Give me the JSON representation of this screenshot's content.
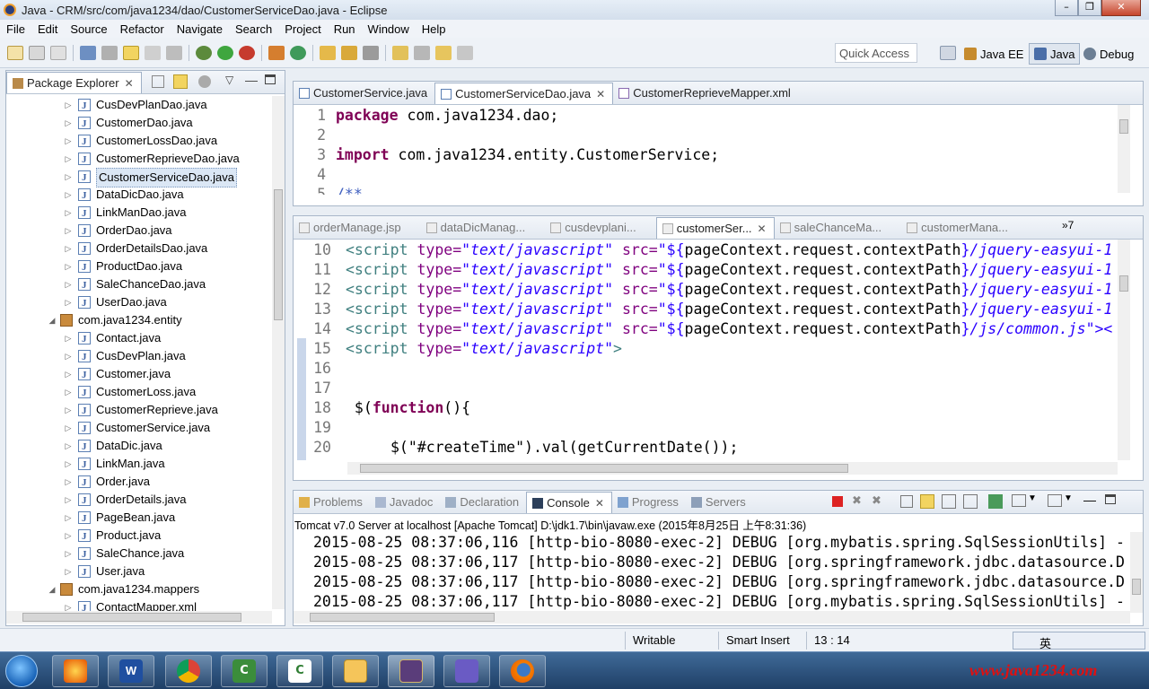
{
  "window": {
    "title": "Java - CRM/src/com/java1234/dao/CustomerServiceDao.java - Eclipse"
  },
  "menu": [
    "File",
    "Edit",
    "Source",
    "Refactor",
    "Navigate",
    "Search",
    "Project",
    "Run",
    "Window",
    "Help"
  ],
  "toolbar": {
    "quick_access": "Quick Access",
    "perspectives": [
      "Java EE",
      "Java",
      "Debug"
    ]
  },
  "package_explorer": {
    "title": "Package Explorer",
    "items": [
      {
        "label": "CusDevPlanDao.java",
        "kind": "file"
      },
      {
        "label": "CustomerDao.java",
        "kind": "file"
      },
      {
        "label": "CustomerLossDao.java",
        "kind": "file"
      },
      {
        "label": "CustomerReprieveDao.java",
        "kind": "file"
      },
      {
        "label": "CustomerServiceDao.java",
        "kind": "file",
        "selected": true
      },
      {
        "label": "DataDicDao.java",
        "kind": "file"
      },
      {
        "label": "LinkManDao.java",
        "kind": "file"
      },
      {
        "label": "OrderDao.java",
        "kind": "file"
      },
      {
        "label": "OrderDetailsDao.java",
        "kind": "file"
      },
      {
        "label": "ProductDao.java",
        "kind": "file"
      },
      {
        "label": "SaleChanceDao.java",
        "kind": "file"
      },
      {
        "label": "UserDao.java",
        "kind": "file"
      },
      {
        "label": "com.java1234.entity",
        "kind": "package"
      },
      {
        "label": "Contact.java",
        "kind": "file"
      },
      {
        "label": "CusDevPlan.java",
        "kind": "file"
      },
      {
        "label": "Customer.java",
        "kind": "file"
      },
      {
        "label": "CustomerLoss.java",
        "kind": "file"
      },
      {
        "label": "CustomerReprieve.java",
        "kind": "file"
      },
      {
        "label": "CustomerService.java",
        "kind": "file"
      },
      {
        "label": "DataDic.java",
        "kind": "file"
      },
      {
        "label": "LinkMan.java",
        "kind": "file"
      },
      {
        "label": "Order.java",
        "kind": "file"
      },
      {
        "label": "OrderDetails.java",
        "kind": "file"
      },
      {
        "label": "PageBean.java",
        "kind": "file"
      },
      {
        "label": "Product.java",
        "kind": "file"
      },
      {
        "label": "SaleChance.java",
        "kind": "file"
      },
      {
        "label": "User.java",
        "kind": "file"
      },
      {
        "label": "com.java1234.mappers",
        "kind": "package"
      },
      {
        "label": "ContactMapper.xml",
        "kind": "file"
      }
    ]
  },
  "editor_top": {
    "tabs": [
      "CustomerService.java",
      "CustomerServiceDao.java",
      "CustomerReprieveMapper.xml"
    ],
    "active_tab": 1,
    "line_numbers": [
      "1",
      "2",
      "3",
      "4",
      "5"
    ],
    "line1_kw": "package",
    "line1_rest": " com.java1234.dao;",
    "line3_kw": "import",
    "line3_rest": " com.java1234.entity.CustomerService;",
    "line5": "/**"
  },
  "editor_bottom": {
    "tabs": [
      "orderManage.jsp",
      "dataDicManag...",
      "cusdevplani...",
      "customerSer...",
      "saleChanceMa...",
      "customerMana..."
    ],
    "active_tab": 3,
    "overflow": "»7",
    "line_numbers": [
      "10",
      "11",
      "12",
      "13",
      "14",
      "15",
      "16",
      "17",
      "18",
      "19",
      "20"
    ],
    "script_tag": "<script",
    "type_attr": " type=",
    "type_val": "\"text/javascript\"",
    "src_attr": " src=",
    "src_open": "\"${",
    "src_expr": "pageContext.request.contextPath",
    "src_close": "}",
    "path_easyui": "/jquery-easyui-1",
    "path_common": "/js/common.js",
    "line14_end": "\"><",
    "line15_end": ">",
    "line18_a": " $(",
    "line18_kw": "function",
    "line18_b": "(){",
    "line20": "$(\"#createTime\").val(getCurrentDate());"
  },
  "console": {
    "tabs": [
      "Problems",
      "Javadoc",
      "Declaration",
      "Console",
      "Progress",
      "Servers"
    ],
    "active_tab": 3,
    "header": "Tomcat v7.0 Server at localhost [Apache Tomcat] D:\\jdk1.7\\bin\\javaw.exe (2015年8月25日 上午8:31:36)",
    "lines": [
      "2015-08-25 08:37:06,116 [http-bio-8080-exec-2] DEBUG [org.mybatis.spring.SqlSessionUtils] -",
      "2015-08-25 08:37:06,117 [http-bio-8080-exec-2] DEBUG [org.springframework.jdbc.datasource.D",
      "2015-08-25 08:37:06,117 [http-bio-8080-exec-2] DEBUG [org.springframework.jdbc.datasource.D",
      "2015-08-25 08:37:06,117 [http-bio-8080-exec-2] DEBUG [org.mybatis.spring.SqlSessionUtils] -"
    ]
  },
  "statusbar": {
    "mode": "Writable",
    "insert": "Smart Insert",
    "position": "13 : 14",
    "ime": "英"
  },
  "watermark": "www.java1234.com",
  "colors": {
    "accent": "#3f6a98",
    "keyword": "#7f0055",
    "string": "#2a00ff"
  }
}
